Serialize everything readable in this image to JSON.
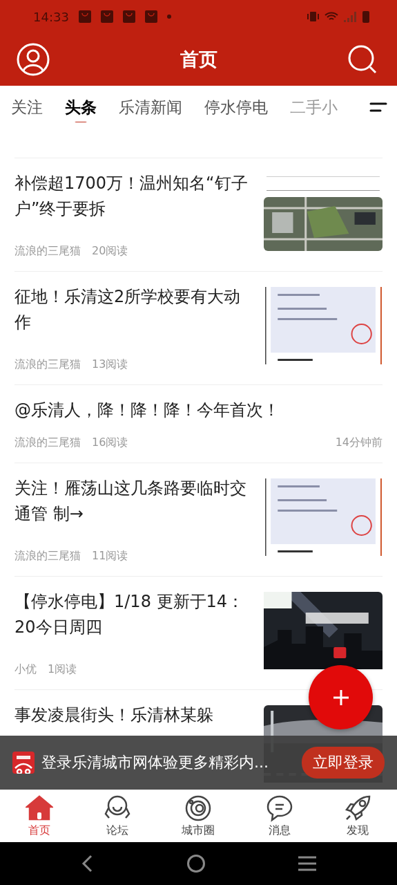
{
  "status_bar": {
    "time": "14:33"
  },
  "header": {
    "title": "首页"
  },
  "tabs": [
    {
      "label": "关注",
      "selected": false
    },
    {
      "label": "头条",
      "selected": true
    },
    {
      "label": "乐清新闻",
      "selected": false
    },
    {
      "label": "停水停电",
      "selected": false
    },
    {
      "label": "二手小",
      "selected": false
    }
  ],
  "articles": [
    {
      "title": "补偿超1700万！温州知名“钉子户”终于要拆",
      "author": "流浪的三尾猫",
      "reads": "20阅读"
    },
    {
      "title": "征地！乐清这2所学校要有大动作",
      "author": "流浪的三尾猫",
      "reads": "13阅读"
    },
    {
      "title": "@乐清人，降！降！降！今年首次！",
      "author": "流浪的三尾猫",
      "reads": "16阅读",
      "time": "14分钟前"
    },
    {
      "title": "关注！雁荡山这几条路要临时交通管 制→",
      "author": "流浪的三尾猫",
      "reads": "11阅读"
    },
    {
      "title": "【停水停电】1/18 更新于14：20今日周四",
      "author": "小优",
      "reads": "1阅读"
    },
    {
      "title": "事发凌晨街头！乐清林某躲"
    }
  ],
  "login_banner": {
    "text": "登录乐清城市网体验更多精彩内...",
    "button": "立即登录"
  },
  "bottom_nav": [
    {
      "label": "首页",
      "selected": true
    },
    {
      "label": "论坛",
      "selected": false
    },
    {
      "label": "城市圈",
      "selected": false
    },
    {
      "label": "消息",
      "selected": false
    },
    {
      "label": "发现",
      "selected": false
    }
  ]
}
